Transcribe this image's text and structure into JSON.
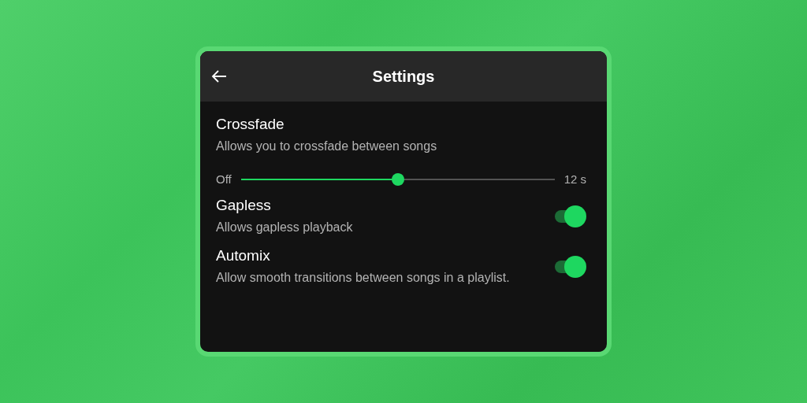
{
  "header": {
    "title": "Settings"
  },
  "items": [
    {
      "kind": "slider",
      "title": "Crossfade",
      "description": "Allows you to crossfade between songs",
      "min_label": "Off",
      "max_label": "12 s",
      "level": 0.5
    },
    {
      "kind": "toggle",
      "title": "Gapless",
      "description": "Allows gapless playback",
      "on": true
    },
    {
      "kind": "toggle",
      "title": "Automix",
      "description": "Allow smooth transitions between songs in a playlist.",
      "on": true
    }
  ]
}
